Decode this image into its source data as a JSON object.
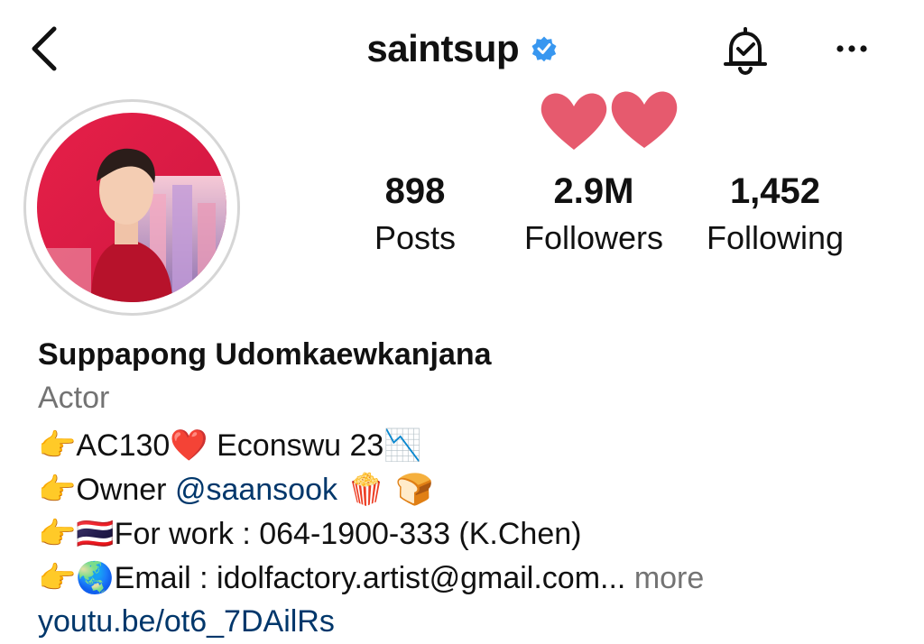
{
  "header": {
    "username": "saintsup",
    "verified": true,
    "icons": [
      "back-chevron-icon",
      "verified-badge-icon",
      "notification-bell-icon",
      "more-options-icon"
    ],
    "accent_color": "#3897f0"
  },
  "decoration": {
    "hearts_color": "#e65a6e"
  },
  "stats": {
    "posts": {
      "value": "898",
      "label": "Posts"
    },
    "followers": {
      "value": "2.9M",
      "label": "Followers"
    },
    "following": {
      "value": "1,452",
      "label": "Following"
    }
  },
  "bio": {
    "full_name": "Suppapong Udomkaewkanjana",
    "category": "Actor",
    "lines": [
      {
        "prefix": "👉",
        "text": "AC130",
        "emoji_after": "❤️",
        "text2": " Econswu 23",
        "emoji_end": "📉"
      },
      {
        "prefix": "👉",
        "text": "Owner ",
        "mention": "@saansook",
        "emoji_end": " 🍿 🍞"
      },
      {
        "prefix": "👉🇹🇭",
        "text": "For work : 064-1900-333 (K.Chen)"
      },
      {
        "prefix": "👉🌏",
        "text": "Email : idolfactory.artist@gmail.com",
        "ellipsis": "...",
        "more": " more"
      }
    ],
    "link": "youtu.be/ot6_7DAilRs"
  }
}
